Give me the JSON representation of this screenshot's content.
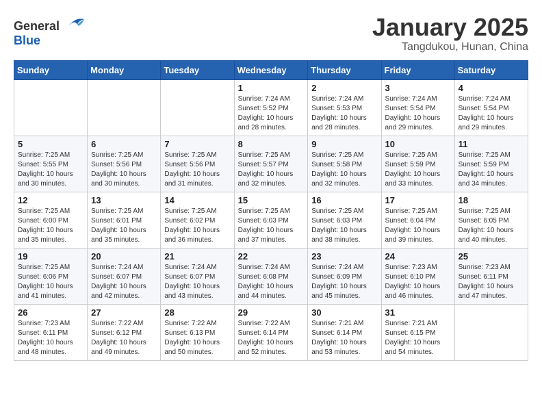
{
  "header": {
    "logo_general": "General",
    "logo_blue": "Blue",
    "month_title": "January 2025",
    "location": "Tangdukou, Hunan, China"
  },
  "days_of_week": [
    "Sunday",
    "Monday",
    "Tuesday",
    "Wednesday",
    "Thursday",
    "Friday",
    "Saturday"
  ],
  "weeks": [
    [
      {
        "day": "",
        "info": ""
      },
      {
        "day": "",
        "info": ""
      },
      {
        "day": "",
        "info": ""
      },
      {
        "day": "1",
        "info": "Sunrise: 7:24 AM\nSunset: 5:52 PM\nDaylight: 10 hours\nand 28 minutes."
      },
      {
        "day": "2",
        "info": "Sunrise: 7:24 AM\nSunset: 5:53 PM\nDaylight: 10 hours\nand 28 minutes."
      },
      {
        "day": "3",
        "info": "Sunrise: 7:24 AM\nSunset: 5:54 PM\nDaylight: 10 hours\nand 29 minutes."
      },
      {
        "day": "4",
        "info": "Sunrise: 7:24 AM\nSunset: 5:54 PM\nDaylight: 10 hours\nand 29 minutes."
      }
    ],
    [
      {
        "day": "5",
        "info": "Sunrise: 7:25 AM\nSunset: 5:55 PM\nDaylight: 10 hours\nand 30 minutes."
      },
      {
        "day": "6",
        "info": "Sunrise: 7:25 AM\nSunset: 5:56 PM\nDaylight: 10 hours\nand 30 minutes."
      },
      {
        "day": "7",
        "info": "Sunrise: 7:25 AM\nSunset: 5:56 PM\nDaylight: 10 hours\nand 31 minutes."
      },
      {
        "day": "8",
        "info": "Sunrise: 7:25 AM\nSunset: 5:57 PM\nDaylight: 10 hours\nand 32 minutes."
      },
      {
        "day": "9",
        "info": "Sunrise: 7:25 AM\nSunset: 5:58 PM\nDaylight: 10 hours\nand 32 minutes."
      },
      {
        "day": "10",
        "info": "Sunrise: 7:25 AM\nSunset: 5:59 PM\nDaylight: 10 hours\nand 33 minutes."
      },
      {
        "day": "11",
        "info": "Sunrise: 7:25 AM\nSunset: 5:59 PM\nDaylight: 10 hours\nand 34 minutes."
      }
    ],
    [
      {
        "day": "12",
        "info": "Sunrise: 7:25 AM\nSunset: 6:00 PM\nDaylight: 10 hours\nand 35 minutes."
      },
      {
        "day": "13",
        "info": "Sunrise: 7:25 AM\nSunset: 6:01 PM\nDaylight: 10 hours\nand 35 minutes."
      },
      {
        "day": "14",
        "info": "Sunrise: 7:25 AM\nSunset: 6:02 PM\nDaylight: 10 hours\nand 36 minutes."
      },
      {
        "day": "15",
        "info": "Sunrise: 7:25 AM\nSunset: 6:03 PM\nDaylight: 10 hours\nand 37 minutes."
      },
      {
        "day": "16",
        "info": "Sunrise: 7:25 AM\nSunset: 6:03 PM\nDaylight: 10 hours\nand 38 minutes."
      },
      {
        "day": "17",
        "info": "Sunrise: 7:25 AM\nSunset: 6:04 PM\nDaylight: 10 hours\nand 39 minutes."
      },
      {
        "day": "18",
        "info": "Sunrise: 7:25 AM\nSunset: 6:05 PM\nDaylight: 10 hours\nand 40 minutes."
      }
    ],
    [
      {
        "day": "19",
        "info": "Sunrise: 7:25 AM\nSunset: 6:06 PM\nDaylight: 10 hours\nand 41 minutes."
      },
      {
        "day": "20",
        "info": "Sunrise: 7:24 AM\nSunset: 6:07 PM\nDaylight: 10 hours\nand 42 minutes."
      },
      {
        "day": "21",
        "info": "Sunrise: 7:24 AM\nSunset: 6:07 PM\nDaylight: 10 hours\nand 43 minutes."
      },
      {
        "day": "22",
        "info": "Sunrise: 7:24 AM\nSunset: 6:08 PM\nDaylight: 10 hours\nand 44 minutes."
      },
      {
        "day": "23",
        "info": "Sunrise: 7:24 AM\nSunset: 6:09 PM\nDaylight: 10 hours\nand 45 minutes."
      },
      {
        "day": "24",
        "info": "Sunrise: 7:23 AM\nSunset: 6:10 PM\nDaylight: 10 hours\nand 46 minutes."
      },
      {
        "day": "25",
        "info": "Sunrise: 7:23 AM\nSunset: 6:11 PM\nDaylight: 10 hours\nand 47 minutes."
      }
    ],
    [
      {
        "day": "26",
        "info": "Sunrise: 7:23 AM\nSunset: 6:11 PM\nDaylight: 10 hours\nand 48 minutes."
      },
      {
        "day": "27",
        "info": "Sunrise: 7:22 AM\nSunset: 6:12 PM\nDaylight: 10 hours\nand 49 minutes."
      },
      {
        "day": "28",
        "info": "Sunrise: 7:22 AM\nSunset: 6:13 PM\nDaylight: 10 hours\nand 50 minutes."
      },
      {
        "day": "29",
        "info": "Sunrise: 7:22 AM\nSunset: 6:14 PM\nDaylight: 10 hours\nand 52 minutes."
      },
      {
        "day": "30",
        "info": "Sunrise: 7:21 AM\nSunset: 6:14 PM\nDaylight: 10 hours\nand 53 minutes."
      },
      {
        "day": "31",
        "info": "Sunrise: 7:21 AM\nSunset: 6:15 PM\nDaylight: 10 hours\nand 54 minutes."
      },
      {
        "day": "",
        "info": ""
      }
    ]
  ]
}
